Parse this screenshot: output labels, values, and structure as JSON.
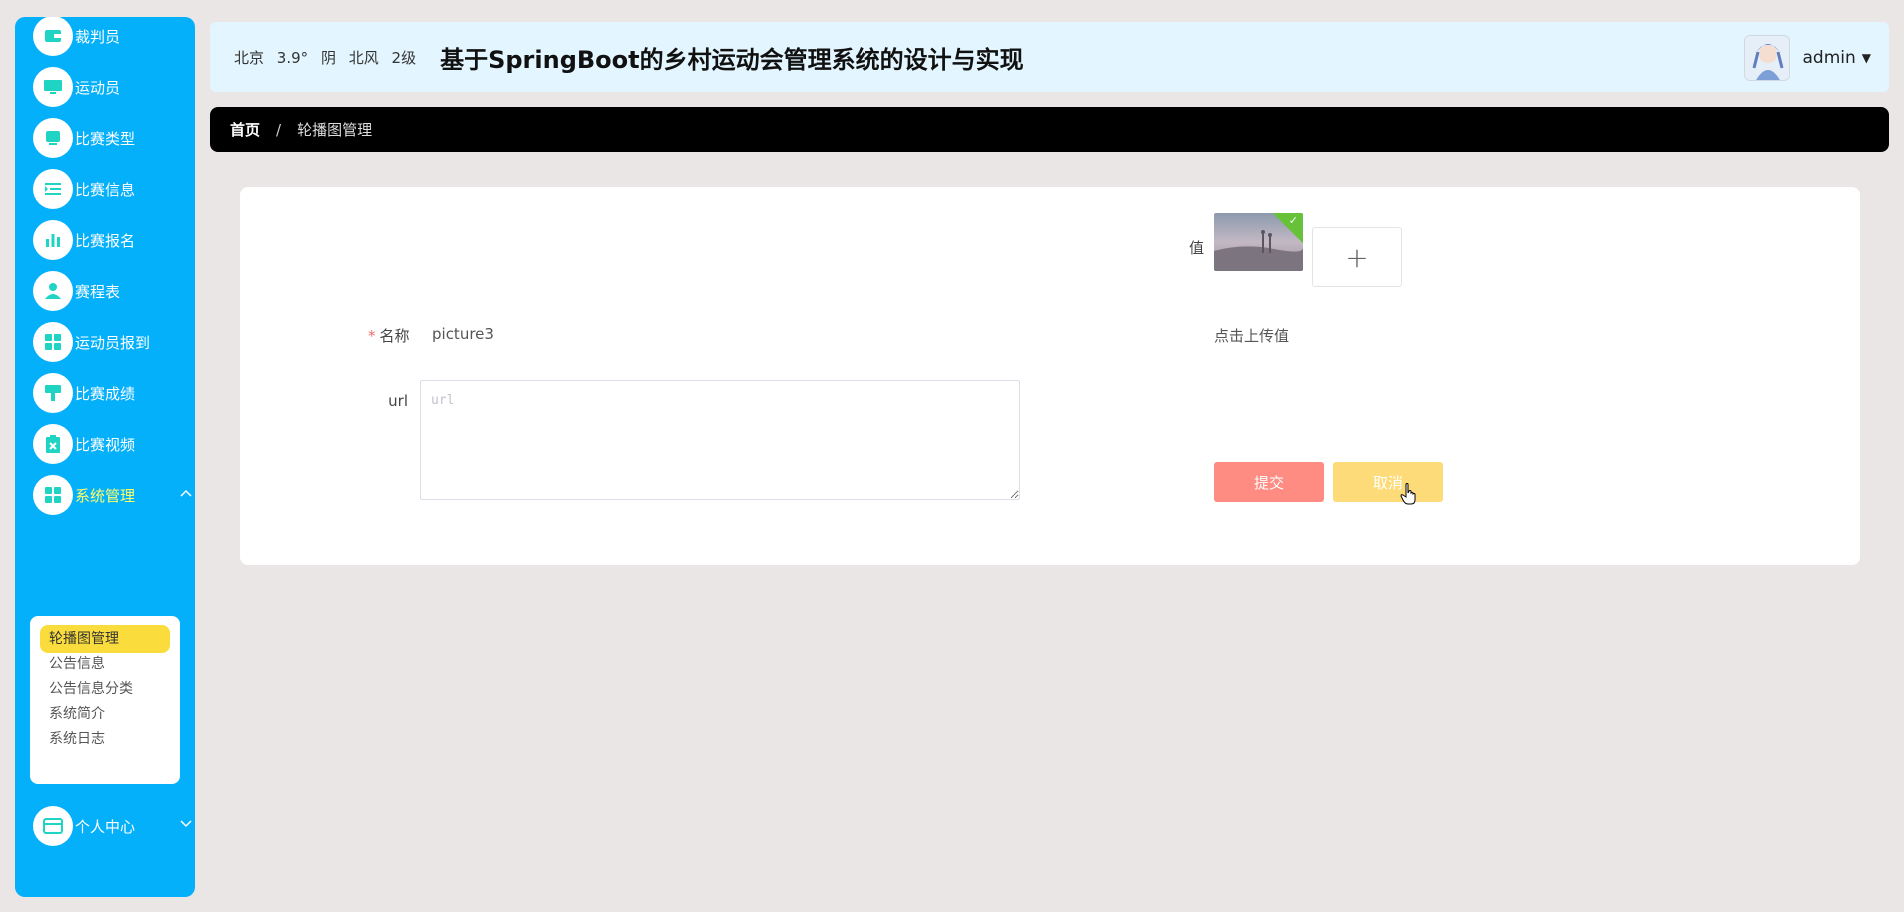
{
  "sidebar": {
    "items": [
      {
        "label": "裁判员",
        "icon": "wallet-icon"
      },
      {
        "label": "运动员",
        "icon": "monitor-icon"
      },
      {
        "label": "比赛类型",
        "icon": "tablet-icon"
      },
      {
        "label": "比赛信息",
        "icon": "list-indent-icon"
      },
      {
        "label": "比赛报名",
        "icon": "bar-chart-icon"
      },
      {
        "label": "赛程表",
        "icon": "user-icon"
      },
      {
        "label": "运动员报到",
        "icon": "grid-icon"
      },
      {
        "label": "比赛成绩",
        "icon": "brush-icon"
      },
      {
        "label": "比赛视频",
        "icon": "clipboard-x-icon"
      },
      {
        "label": "系统管理",
        "icon": "grid-icon"
      },
      {
        "label": "个人中心",
        "icon": "card-icon"
      }
    ],
    "submenu": [
      "轮播图管理",
      "公告信息",
      "公告信息分类",
      "系统简介",
      "系统日志"
    ]
  },
  "header": {
    "weather": {
      "city": "北京",
      "temp": "3.9°",
      "condition": "阴",
      "wind_dir": "北风",
      "wind_level": "2级"
    },
    "title": "基于SpringBoot的乡村运动会管理系统的设计与实现",
    "username": "admin"
  },
  "breadcrumb": {
    "home": "首页",
    "separator": "/",
    "current": "轮播图管理"
  },
  "form": {
    "name_label": "名称",
    "name_required": "*",
    "name_value": "picture3",
    "url_label": "url",
    "url_placeholder": "url",
    "value_label": "值",
    "upload_plus": "+",
    "upload_hint": "点击上传值",
    "submit": "提交",
    "cancel": "取消"
  },
  "colors": {
    "sidebar_bg": "#05b0fb",
    "active_submenu": "#fadd3c",
    "submit_btn": "#ff8c82",
    "cancel_btn": "#fedb79",
    "header_bg": "#e3f5fe"
  }
}
